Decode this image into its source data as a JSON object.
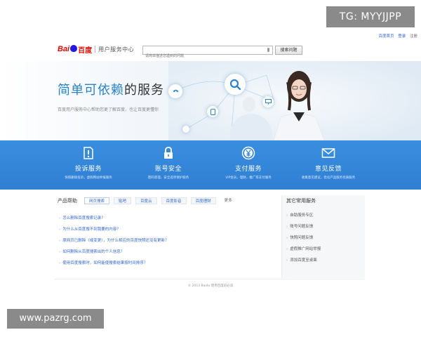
{
  "watermarks": {
    "top": "TG: MYYJJPP",
    "bottom": "www.pazrg.com"
  },
  "top_links": {
    "home": "百度首页",
    "login": "登录",
    "register": "注册"
  },
  "header": {
    "logo_text": "Bai",
    "logo_du": "百度",
    "center_title": "用户服务中心",
    "search_placeholder": "请简单描述您遇到的问题",
    "search_button": "搜索问题"
  },
  "hero": {
    "title_blue": "简单可依赖",
    "title_dark": "的服务",
    "subtitle": "百度用户服务中心帮助您更了解百度，也让百度更懂你"
  },
  "services": [
    {
      "icon": "report-icon",
      "title": "投诉服务",
      "desc": "快照删除投诉，虚假网站举报服务"
    },
    {
      "icon": "lock-icon",
      "title": "账号安全",
      "desc": "密码管理，安全选项保护服务"
    },
    {
      "icon": "yen-icon",
      "title": "支付服务",
      "desc": "VIP会员，理财，推广等支付服务"
    },
    {
      "icon": "mail-icon",
      "title": "意见反馈",
      "desc": "收集意见建议，优化产品服务优质服务"
    }
  ],
  "help": {
    "label": "产品帮助",
    "tabs": [
      "网页搜索",
      "贴吧",
      "百度云",
      "百度影音",
      "百度理财"
    ],
    "more": "更多",
    "faqs": [
      "怎么删除百度搜索记录？",
      "为什么从百度搜不到我要的内容？",
      "原网页已删除（或变更），为什么相应的百度快照还没有更新？",
      "如何删除从百度搜索出的个人信息？",
      "使用百度搜索时，如何能使搜索结果按时间排序？"
    ]
  },
  "common_services": {
    "title": "其它常用服务",
    "items": [
      "自助服务专区",
      "账号问题反馈",
      "快照问题反馈",
      "虚假推广网站举报",
      "添加百度至桌面"
    ]
  },
  "footer": {
    "copyright": "© 2013 Baidu 使用百度前必读"
  },
  "colors": {
    "accent_blue": "#2f7fd3",
    "title_blue": "#2b83c7",
    "link_blue": "#3366cc",
    "brand_red": "#e10602"
  }
}
